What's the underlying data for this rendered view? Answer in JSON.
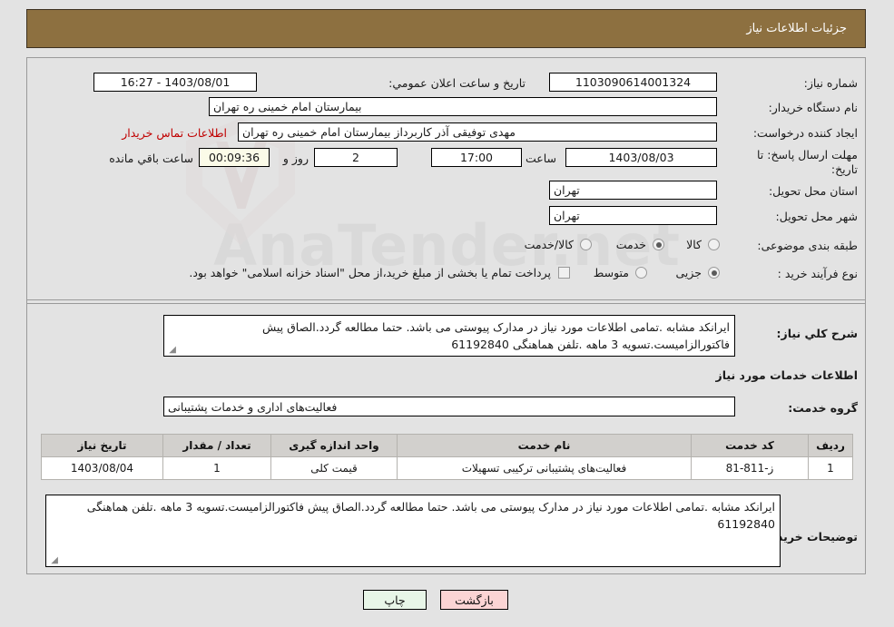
{
  "header": {
    "title": "جزئیات اطلاعات نیاز"
  },
  "fields": {
    "need_number_label": "شماره نیاز:",
    "need_number_value": "1103090614001324",
    "public_announce_label": "تاریخ و ساعت اعلان عمومي:",
    "public_announce_value": "1403/08/01 - 16:27",
    "buyer_org_label": "نام دستگاه خریدار:",
    "buyer_org_value": "بیمارستان امام خمینی ره  تهران",
    "creator_label": "ایجاد کننده درخواست:",
    "creator_value": "مهدی توفیقی آذر کاربرداز بیمارستان امام خمینی ره  تهران",
    "contact_link": "اطلاعات تماس خریدار",
    "deadline_label": "مهلت ارسال پاسخ: تا تاریخ:",
    "deadline_date": "1403/08/03",
    "hour_label": "ساعت",
    "hour_value": "17:00",
    "days_value": "2",
    "days_suffix": "روز و",
    "countdown_value": "00:09:36",
    "countdown_suffix": "ساعت باقي مانده",
    "province_label": "استان محل تحویل:",
    "province_value": "تهران",
    "city_label": "شهر محل تحویل:",
    "city_value": "تهران",
    "category_label": "طبقه بندی موضوعی:",
    "purchase_type_label": "نوع فرآیند خرید :",
    "treasury_note": "پرداخت تمام یا بخشی از مبلغ خرید،از محل \"اسناد خزانه اسلامی\" خواهد بود.",
    "general_desc_label": "شرح کلي نیاز:",
    "general_desc_value": "ایرانکد مشابه .تمامی اطلاعات مورد نیاز در مدارک پیوستی می باشد. حتما مطالعه گردد.الصاق پیش فاکتورالزامیست.تسویه 3 ماهه .تلفن هماهنگی 61192840",
    "services_info_heading": "اطلاعات خدمات مورد نیاز",
    "service_group_label": "گروه خدمت:",
    "service_group_value": "فعالیت‌های اداری و خدمات پشتیبانی",
    "buyer_notes_label": "توضیحات خریدار:",
    "buyer_notes_value": "ایرانکد مشابه .تمامی اطلاعات مورد نیاز در مدارک پیوستی می باشد. حتما مطالعه گردد.الصاق پیش فاکتورالزامیست.تسویه 3 ماهه .تلفن هماهنگی 61192840"
  },
  "category_options": [
    {
      "label": "کالا",
      "selected": false
    },
    {
      "label": "خدمت",
      "selected": true
    },
    {
      "label": "کالا/خدمت",
      "selected": false
    }
  ],
  "purchase_type_options": [
    {
      "label": "جزیی",
      "selected": true
    },
    {
      "label": "متوسط",
      "selected": false
    }
  ],
  "treasury_checkbox": {
    "checked": false
  },
  "table": {
    "headers": [
      "ردیف",
      "کد خدمت",
      "نام خدمت",
      "واحد اندازه گیری",
      "تعداد / مقدار",
      "تاریخ نیاز"
    ],
    "rows": [
      [
        "1",
        "ز-811-81",
        "فعالیت‌های پشتیبانی ترکیبی تسهیلات",
        "قیمت کلی",
        "1",
        "1403/08/04"
      ]
    ]
  },
  "buttons": {
    "print": "چاپ",
    "back": "بازگشت"
  },
  "colors": {
    "header_bg": "#8d7040",
    "page_bg": "#e3e3e3",
    "link": "#c00000",
    "countdown_bg": "#fbfbe8",
    "print_btn": "#e8f6e8",
    "back_btn": "#fbd4d4",
    "table_header_bg": "#d2d0cd"
  },
  "watermark": {
    "text": "AnaTender.net"
  }
}
